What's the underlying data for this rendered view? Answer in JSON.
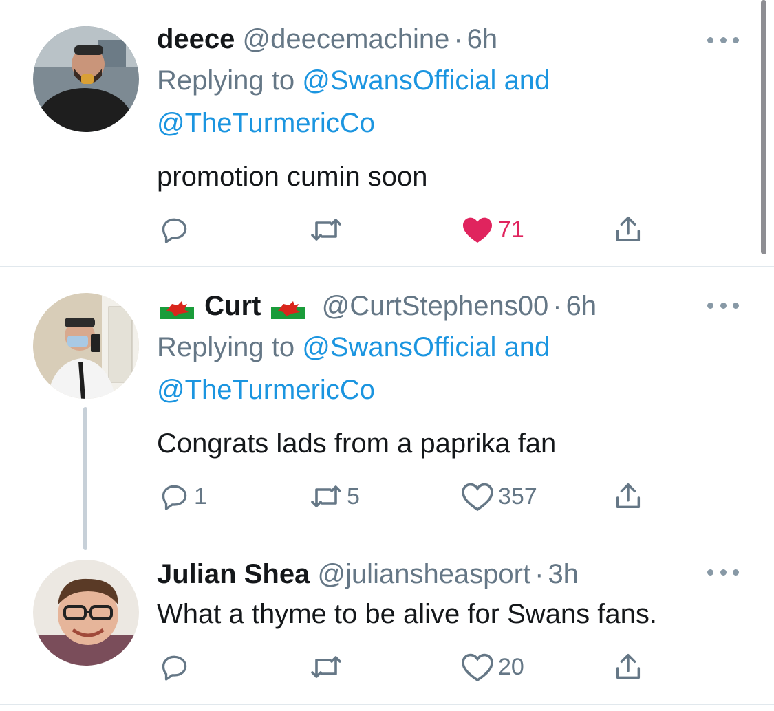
{
  "tweets": [
    {
      "name": "deece",
      "handle": "@deecemachine",
      "dot": "·",
      "time": "6h",
      "replying_prefix": "Replying to",
      "replying_mention1": "@SwansOfficial",
      "replying_and": "and",
      "replying_mention2": "@TheTurmericCo",
      "text": "promotion cumin soon",
      "replies": "",
      "retweets": "",
      "likes": "71",
      "liked": true
    },
    {
      "name": "Curt",
      "handle": "@CurtStephens00",
      "dot": "·",
      "time": "6h",
      "replying_prefix": "Replying to",
      "replying_mention1": "@SwansOfficial",
      "replying_and": "and",
      "replying_mention2": "@TheTurmericCo",
      "text": "Congrats lads from a paprika fan",
      "replies": "1",
      "retweets": "5",
      "likes": "357",
      "liked": false
    },
    {
      "name": "Julian Shea",
      "handle": "@juliansheasport",
      "dot": "·",
      "time": "3h",
      "text": "What a thyme to be alive for Swans fans.",
      "replies": "",
      "retweets": "",
      "likes": "20",
      "liked": false
    }
  ],
  "icons": {
    "reply": "reply-icon",
    "retweet": "retweet-icon",
    "like": "heart-icon",
    "share": "share-icon",
    "more": "more-icon",
    "flag": "welsh-flag-icon"
  },
  "colors": {
    "link": "#1b95e0",
    "muted": "#657786",
    "like_active": "#e0245e",
    "text": "#14171a"
  }
}
